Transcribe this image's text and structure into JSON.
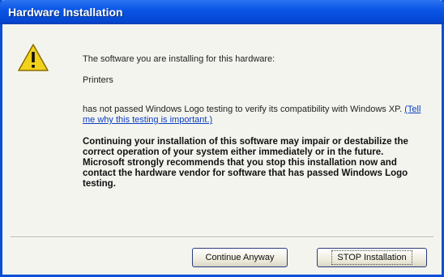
{
  "window": {
    "title": "Hardware Installation"
  },
  "message": {
    "line1": "The software you are installing for this hardware:",
    "device": "Printers",
    "line3_prefix": "has not passed Windows Logo testing to verify its compatibility with Windows XP.",
    "link": "(Tell me why this testing is important.)",
    "warning": "Continuing your installation of this software may impair or destabilize the correct operation of your system either immediately or in the future. Microsoft strongly recommends that you stop this installation now and contact the hardware vendor for software that has passed Windows Logo testing."
  },
  "buttons": {
    "continue": "Continue Anyway",
    "stop": "STOP Installation"
  },
  "colors": {
    "titlebar": "#0a56e6",
    "warning_icon": "#f2d21b"
  },
  "icons": {
    "warning": "warning-icon"
  }
}
